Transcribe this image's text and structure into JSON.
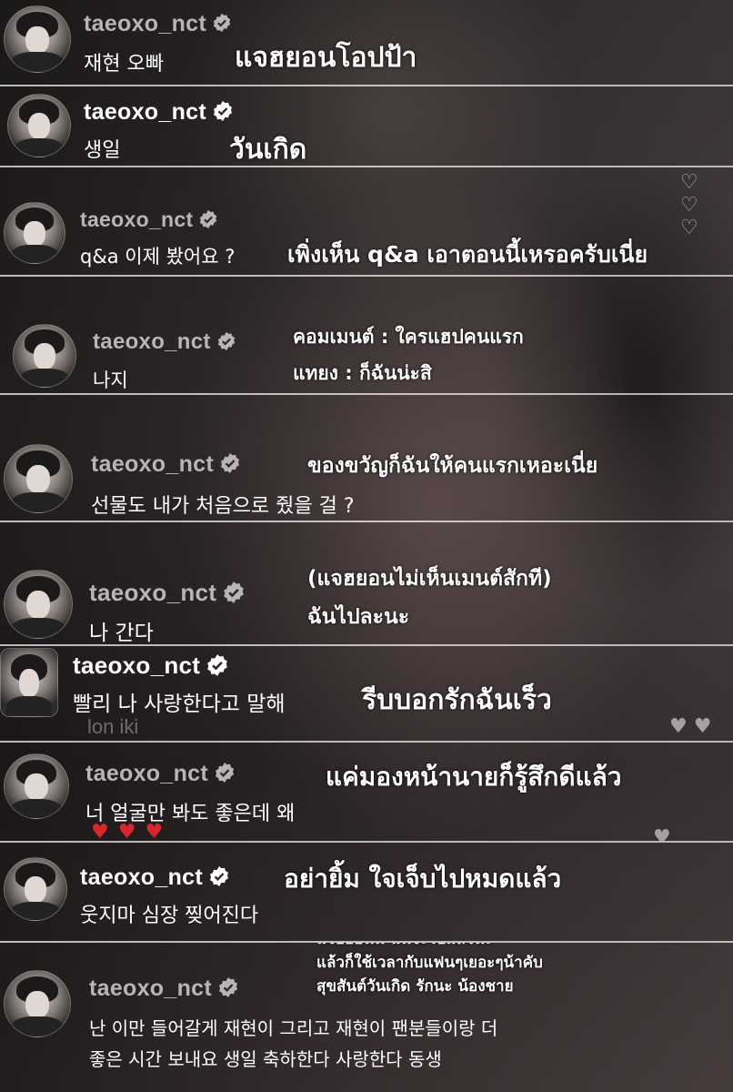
{
  "username": "taeoxo_nct",
  "icons": {
    "verified": "verified-badge-icon",
    "avatar": "profile-avatar"
  },
  "colors": {
    "badge": "#ffffff",
    "username_dim": "#b9b5b4",
    "heart_red": "#d8262f"
  },
  "comments": [
    {
      "korean": "재현 오빠",
      "thai": [
        "แจฮยอนโอปป้า"
      ]
    },
    {
      "korean": "생일",
      "thai": [
        "วันเกิด"
      ]
    },
    {
      "korean": "q&a 이제 봤어요 ?",
      "thai": [
        "เพิ่งเห็น q&a เอาตอนนี้เหรอครับเนี่ย"
      ]
    },
    {
      "korean": "나지",
      "thai": [
        "คอมเมนต์ : ใครแฮปคนแรก",
        "แทยง : ก็ฉันน่ะสิ"
      ]
    },
    {
      "korean": "선물도 내가 처음으로 줬을 걸 ?",
      "thai": [
        "ของขวัญก็ฉันให้คนแรกเหอะเนี่ย"
      ]
    },
    {
      "korean": "나 간다",
      "thai": [
        "(แจฮยอนไม่เห็นเมนต์สักที)",
        "ฉันไปละนะ"
      ]
    },
    {
      "korean": "빨리 나 사랑한다고 말해",
      "thai": [
        "รีบบอกรักฉันเร็ว"
      ]
    },
    {
      "korean": "너 얼굴만 봐도 좋은데 왜",
      "thai": [
        "แค่มองหน้านายก็รู้สึกดีแล้ว"
      ]
    },
    {
      "korean": "웃지마 심장 찢어진다",
      "thai": [
        "อย่ายิ้ม ใจเจ็บไปหมดแล้ว"
      ]
    },
    {
      "korean": [
        "난 이만 들어갈게 재현이 그리고 재현이 팬분들이랑 더",
        "좋은 시간 보내요 생일 축하한다 사랑한다 동생"
      ],
      "thai": [
        "แจฮยอนนี่ ฉันจะไปแล้วนะ",
        "แล้วก็ใช้เวลากับแฟนๆเยอะๆน้าคับ",
        "สุขสันต์วันเกิด รักนะ น้องชาย"
      ]
    }
  ],
  "background_text": "lon iki"
}
